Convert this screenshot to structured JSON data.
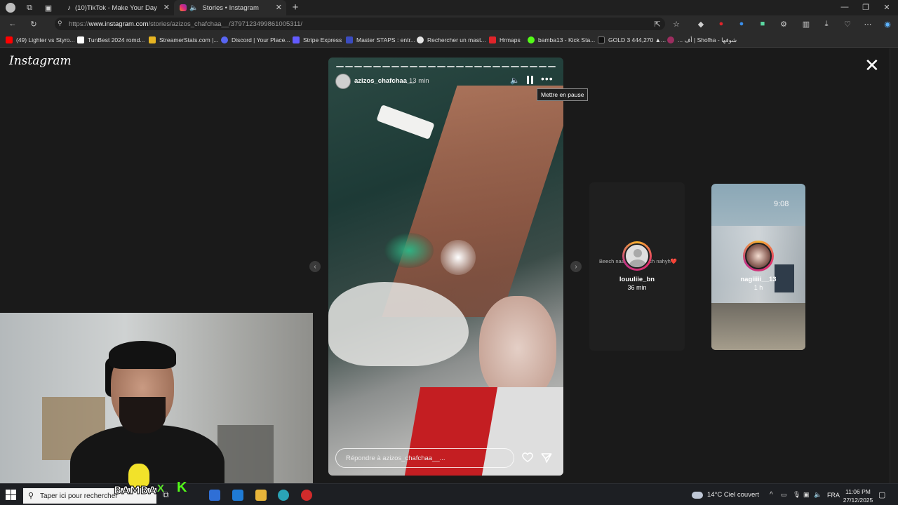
{
  "browser": {
    "tabs": [
      {
        "title": "(10)TikTok - Make Your Day"
      },
      {
        "title": "Stories • Instagram"
      }
    ],
    "url": {
      "prefix": "https://",
      "host": "www.instagram.com",
      "path": "/stories/azizos_chafchaa__/3797123499861005311/"
    },
    "bookmarks": [
      {
        "label": "(49) Lighter vs Styro...",
        "color": "#ff0000"
      },
      {
        "label": "TunBest 2024 romd...",
        "color": "#ffffff"
      },
      {
        "label": "StreamerStats.com |...",
        "color": "#e6b422"
      },
      {
        "label": "Discord | Your Place...",
        "color": "#5865f2"
      },
      {
        "label": "Stripe Express",
        "color": "#635bff"
      },
      {
        "label": "Master STAPS : entr...",
        "color": "#3b4cc0"
      },
      {
        "label": "Rechercher un mast...",
        "color": "#e5e5e5"
      },
      {
        "label": "Hrmaps",
        "color": "#e0242a"
      },
      {
        "label": "bamba13 - Kick Sta...",
        "color": "#53fc18"
      },
      {
        "label": "GOLD 3 444,270 ▲...",
        "color": "#111111"
      },
      {
        "label": "... أف | Shofha - شوفها",
        "color": "#9c2d5f"
      }
    ]
  },
  "instagram": {
    "logo": "Instagram",
    "story": {
      "username": "azizos_chafchaa__",
      "time": "13 min",
      "tooltip": "Mettre en pause",
      "reply_placeholder": "Répondre à azizos_chafchaa__..."
    },
    "next_stories": [
      {
        "preview_text": "Beech naa... hedha bch nahyh❤️",
        "username": "louuliie_bn",
        "time": "36 min"
      },
      {
        "clock": "9:08",
        "username": "nagiiiii__13",
        "time": "1 h"
      }
    ]
  },
  "overlay": {
    "brand_left": "BAMBA",
    "brand_x": "X",
    "brand_k": "K"
  },
  "taskbar": {
    "search_placeholder": "Taper ici pour rechercher",
    "weather": "14°C  Ciel couvert",
    "language": "FRA",
    "time": "11:06 PM",
    "date": "27/12/2025"
  }
}
